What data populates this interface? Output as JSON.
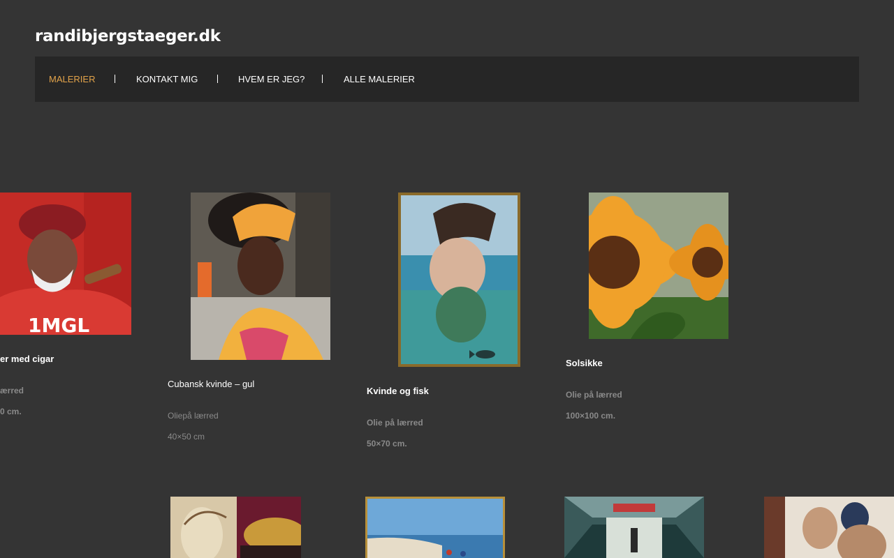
{
  "site": {
    "title": "randibjergstaeger.dk"
  },
  "nav": {
    "items": [
      "MALERIER",
      "KONTAKT MIG",
      "HVEM ER JEG?",
      "ALLE MALERIER"
    ],
    "active": "MALERIER",
    "colors": {
      "active": "#e2a34a",
      "text": "#ffffff",
      "background": "#262626"
    }
  },
  "paintings": [
    {
      "title": "er med cigar",
      "medium": "ærred",
      "size": "0 cm."
    },
    {
      "title": "Cubansk kvinde – gul",
      "medium": "Oliepå lærred",
      "size": "40×50 cm"
    },
    {
      "title": "Kvinde og fisk",
      "medium": "Olie på lærred",
      "size": "50×70 cm."
    },
    {
      "title": "Solsikke",
      "medium": "Olie på lærred",
      "size": "100×100 cm."
    }
  ]
}
